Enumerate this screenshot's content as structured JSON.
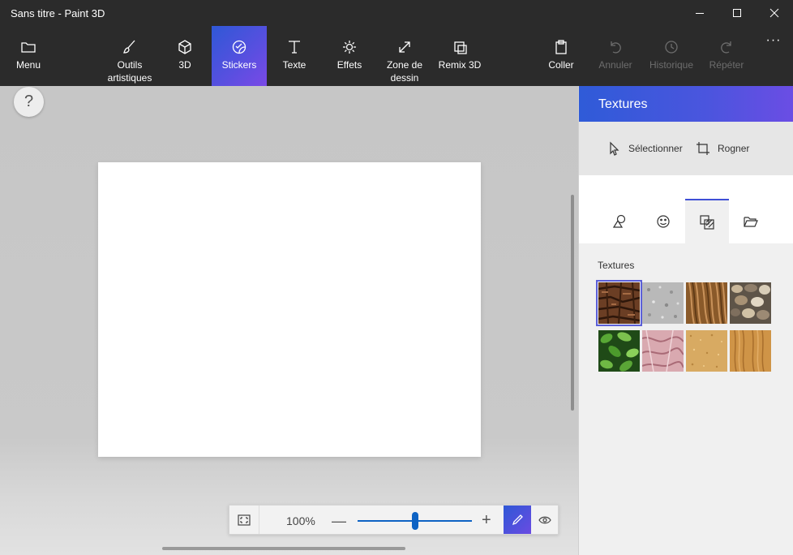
{
  "window": {
    "title": "Sans titre - Paint 3D"
  },
  "toolbar": {
    "menu": "Menu",
    "art_tools": "Outils artistiques",
    "three_d": "3D",
    "stickers": "Stickers",
    "text": "Texte",
    "effects": "Effets",
    "canvas": "Zone de dessin",
    "remix": "Remix 3D",
    "paste": "Coller",
    "undo": "Annuler",
    "history": "Historique",
    "redo": "Répéter",
    "more": "···"
  },
  "help": {
    "label": "?"
  },
  "zoom": {
    "percent": "100%",
    "minus": "—",
    "plus": "+",
    "level": 0.5
  },
  "panel": {
    "title": "Textures",
    "select": "Sélectionner",
    "crop": "Rogner",
    "section": "Textures",
    "textures": [
      "bark",
      "granite",
      "hair",
      "pebbles",
      "leaves",
      "pink-marble",
      "sand",
      "wood"
    ],
    "selected_index": 0
  },
  "colors": {
    "chrome": "#2b2b2b",
    "accent_start": "#2f58d6",
    "accent_end": "#6b4de4",
    "slider": "#0e63c4"
  }
}
